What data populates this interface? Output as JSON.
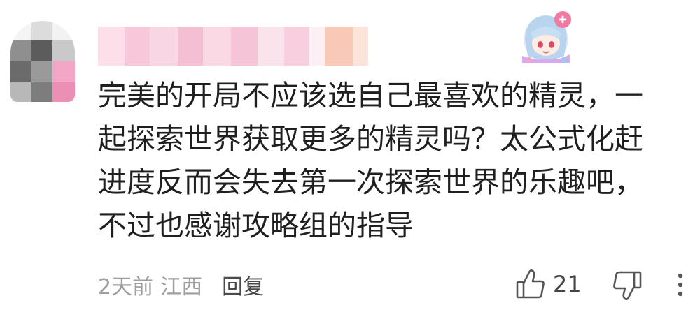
{
  "colors": {
    "text": "#1f1f1f",
    "meta": "#9e9e9e",
    "reply": "#4a4a4a",
    "icon": "#555555",
    "username_blur": "#f6c6d8",
    "username_blur_accent": "#f7b9a8"
  },
  "comment": {
    "user": {
      "avatar_icon": "pixelated-avatar",
      "name_hidden": true,
      "badge_icon": "anime-girl-badge"
    },
    "text": "完美的开局不应该选自己最喜欢的精灵，一\n起探索世界获取更多的精灵吗？太公式化赶\n进度反而会失去第一次探索世界的乐趣吧，\n不过也感谢攻略组的指导",
    "time": "2天前",
    "location": "江西",
    "reply_label": "回复",
    "likes": "21"
  },
  "icons": {
    "like": "thumbs-up-icon",
    "dislike": "thumbs-down-icon",
    "more": "more-vertical-icon"
  }
}
